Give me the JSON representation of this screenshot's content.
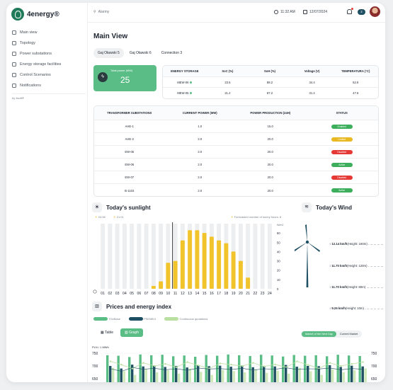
{
  "brand": "4energy®",
  "nav": [
    {
      "label": "Main view",
      "icon": "grid-icon"
    },
    {
      "label": "Topology",
      "icon": "topology-icon"
    },
    {
      "label": "Power substations",
      "icon": "substation-icon"
    },
    {
      "label": "Energy storage facilities",
      "icon": "storage-icon"
    },
    {
      "label": "Control Scenarios",
      "icon": "control-icon"
    },
    {
      "label": "Notifications",
      "icon": "bell-icon"
    }
  ],
  "by": "by 4soft®",
  "topbar": {
    "alarm": "Alarmy",
    "time": "11:32 AM",
    "date": "12/07/2024",
    "notif_count": "2"
  },
  "page_title": "Main View",
  "tabs": [
    "Gaj Oławski 5",
    "Gaj Oławski 6",
    "Connection 3"
  ],
  "total_power": {
    "label": "Total power (MW)",
    "value": "25"
  },
  "storage": {
    "headers": [
      "ENERGY STORAGE",
      "SoC (%)",
      "SoH (%)",
      "Voltage (V)",
      "TEMPERATURA (°C)"
    ],
    "rows": [
      [
        "MEW-06",
        "23.5",
        "88.2",
        "34.4",
        "52.6"
      ],
      [
        "MEW-05",
        "21.2",
        "87.2",
        "31.4",
        "47.6"
      ]
    ]
  },
  "substations": {
    "headers": [
      "TRANSFORMER SUBSTATIONS",
      "CURRENT POWER (MW)",
      "POWER PRODUCTION (24H)",
      "STATUS"
    ],
    "rows": [
      {
        "name": "AHE-1",
        "power": "1.0",
        "prod": "15.0",
        "status": "Enabled",
        "color": "#3cae5c"
      },
      {
        "name": "AHE-2",
        "power": "2.0",
        "prod": "20.0",
        "status": "Limited",
        "color": "#e8b923"
      },
      {
        "name": "EW-05",
        "power": "2.0",
        "prod": "20.0",
        "status": "Disabled",
        "color": "#e53935"
      },
      {
        "name": "EW-06",
        "power": "2.0",
        "prod": "20.0",
        "status": "Active",
        "color": "#3cae5c"
      },
      {
        "name": "EW-07",
        "power": "2.0",
        "prod": "20.0",
        "status": "Disabled",
        "color": "#e53935"
      },
      {
        "name": "B-1103",
        "power": "2.0",
        "prod": "20.0",
        "status": "Active",
        "color": "#3cae5c"
      }
    ]
  },
  "sunlight": {
    "title": "Today's sunlight",
    "sunrise": "04:38",
    "sunset": "21:01",
    "forecast": "Forecasted number of sunny hours: 8"
  },
  "chart_data": [
    {
      "type": "bar",
      "title": "Today's sunlight",
      "ylabel": "W/m2",
      "ylim": [
        0,
        70
      ],
      "yticks": [
        "70",
        "60",
        "50",
        "40",
        "30",
        "20",
        "10",
        "0"
      ],
      "categories": [
        "01",
        "02",
        "03",
        "04",
        "05",
        "06",
        "07",
        "08",
        "09",
        "10",
        "11",
        "12",
        "13",
        "14",
        "15",
        "16",
        "17",
        "18",
        "19",
        "20",
        "21",
        "22",
        "23",
        "24"
      ],
      "values": [
        0,
        0,
        0,
        0,
        0,
        0,
        0,
        3,
        8,
        28,
        30,
        52,
        63,
        63,
        60,
        56,
        52,
        49,
        40,
        30,
        12,
        0,
        0,
        0
      ],
      "current_hour": "11"
    },
    {
      "type": "bar",
      "title": "Prices and energy index",
      "ylabel": "PLN / 1 MWh",
      "ylim": [
        650,
        750
      ],
      "yticks": [
        "750",
        "700",
        "650"
      ],
      "series": [
        {
          "name": "TGeBase"
        },
        {
          "name": "PSEMB II"
        },
        {
          "name": "Continuous quotations"
        }
      ]
    }
  ],
  "wind": {
    "title": "Today's Wind",
    "levels": [
      {
        "speed": "12.14 km/h",
        "height": "(Height: 160m)"
      },
      {
        "speed": "11.70 km/h",
        "height": "(Height: 120m)"
      },
      {
        "speed": "11.70 km/h",
        "height": "(Height: 80m)"
      },
      {
        "speed": "9.26 km/h",
        "height": "(Height: 10m)"
      }
    ]
  },
  "prices": {
    "title": "Prices and energy index",
    "view_table": "Table",
    "view_graph": "Graph",
    "market_next": "Market of the Next Day",
    "market_current": "Current Market"
  }
}
